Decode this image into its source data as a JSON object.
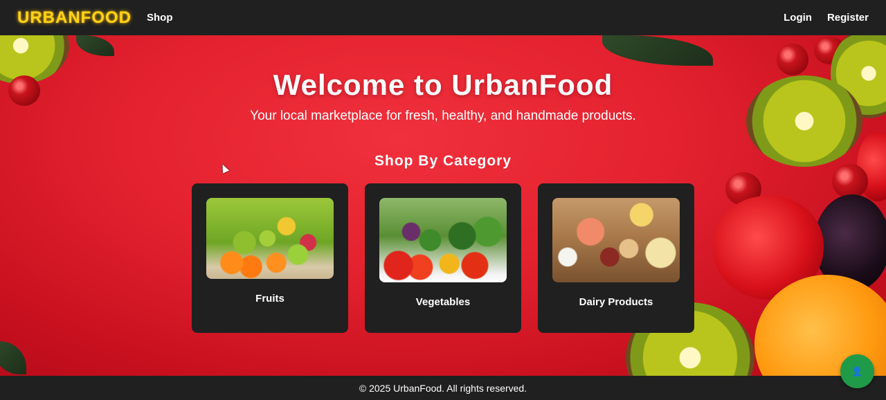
{
  "navbar": {
    "brand": "URBANFOOD",
    "shop_label": "Shop",
    "login_label": "Login",
    "register_label": "Register"
  },
  "hero": {
    "title": "Welcome to UrbanFood",
    "subtitle": "Your local marketplace for fresh, healthy, and handmade products.",
    "section_title": "Shop By Category"
  },
  "categories": [
    {
      "label": "Fruits"
    },
    {
      "label": "Vegetables"
    },
    {
      "label": "Dairy Products"
    }
  ],
  "footer": {
    "text": "© 2025 UrbanFood. All rights reserved."
  },
  "chat_button": {
    "icon": "user-icon"
  },
  "colors": {
    "brand": "#ffd21a",
    "hero_bg": "#e4222f",
    "bar_bg": "#202020",
    "card_bg": "#202020",
    "chat_button": "#1f9a48"
  }
}
